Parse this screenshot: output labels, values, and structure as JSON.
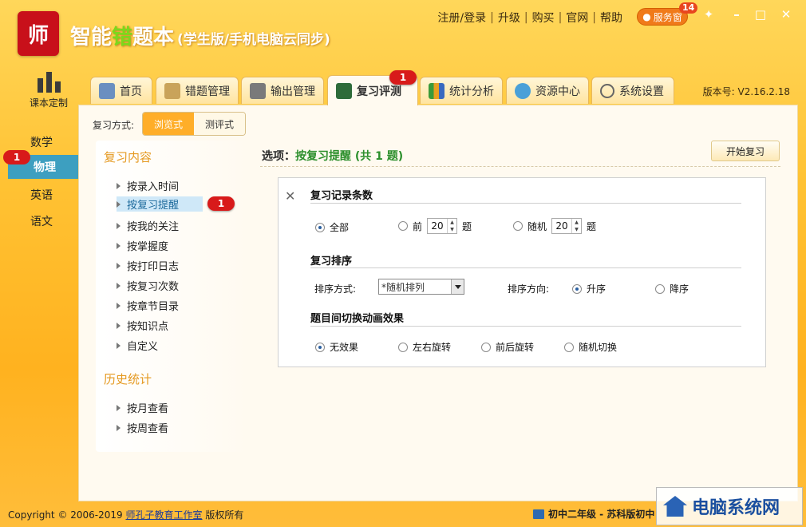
{
  "app": {
    "logo_text": "师",
    "title_part1": "智能",
    "title_part2": "错",
    "title_part3": "题本",
    "subtitle": "(学生版/手机电脑云同步)",
    "version_label": "版本号: V2.16.2.18"
  },
  "top_links": [
    "注册/登录",
    "升级",
    "购买",
    "官网",
    "帮助"
  ],
  "service": {
    "label": "服务窗",
    "badge": "14"
  },
  "tabs": [
    {
      "label": "首页",
      "icon": "home-icon"
    },
    {
      "label": "错题管理",
      "icon": "clipboard-icon"
    },
    {
      "label": "输出管理",
      "icon": "printer-icon"
    },
    {
      "label": "复习评测",
      "icon": "blackboard-icon",
      "active": true,
      "badge": "1"
    },
    {
      "label": "统计分析",
      "icon": "bar-chart-icon"
    },
    {
      "label": "资源中心",
      "icon": "cloud-icon"
    },
    {
      "label": "系统设置",
      "icon": "gear-icon"
    }
  ],
  "sidebar": {
    "course_label": "课本定制",
    "subjects": [
      "数学",
      "物理",
      "英语",
      "语文"
    ],
    "active_subject": "物理",
    "active_badge": "1"
  },
  "mode": {
    "label": "复习方式:",
    "options": [
      "浏览式",
      "测评式"
    ]
  },
  "review_content": {
    "title": "复习内容",
    "items": [
      "按录入时间",
      "按复习提醒",
      "按我的关注",
      "按掌握度",
      "按打印日志",
      "按复习次数",
      "按章节目录",
      "按知识点",
      "自定义"
    ],
    "selected_badge": "1"
  },
  "history": {
    "title": "历史统计",
    "items": [
      "按月查看",
      "按周查看"
    ]
  },
  "options_header": {
    "prefix": "选项：",
    "value": "按复习提醒 (共 1 题)",
    "start_button": "开始复习"
  },
  "settings": {
    "count_title": "复习记录条数",
    "count_all": "全部",
    "count_first": "前",
    "count_first_value": "20",
    "count_unit": "题",
    "count_random": "随机",
    "count_random_value": "20",
    "sort_title": "复习排序",
    "sort_mode_label": "排序方式:",
    "sort_mode_value": "*随机排列",
    "sort_dir_label": "排序方向:",
    "sort_asc": "升序",
    "sort_desc": "降序",
    "anim_title": "题目间切换动画效果",
    "anim_options": [
      "无效果",
      "左右旋转",
      "前后旋转",
      "随机切换"
    ]
  },
  "footer": {
    "copyright": "Copyright © 2006-2019",
    "brand": "师孔子教育工作室",
    "rights": "版权所有",
    "grade": "初中二年级 - 苏科版初中"
  },
  "watermark": {
    "text": "电脑系统网"
  },
  "colors": {
    "accent": "#ffae29",
    "panel": "#fffaf0",
    "badge": "#d81a1a",
    "selected": "#3d9fc0"
  }
}
